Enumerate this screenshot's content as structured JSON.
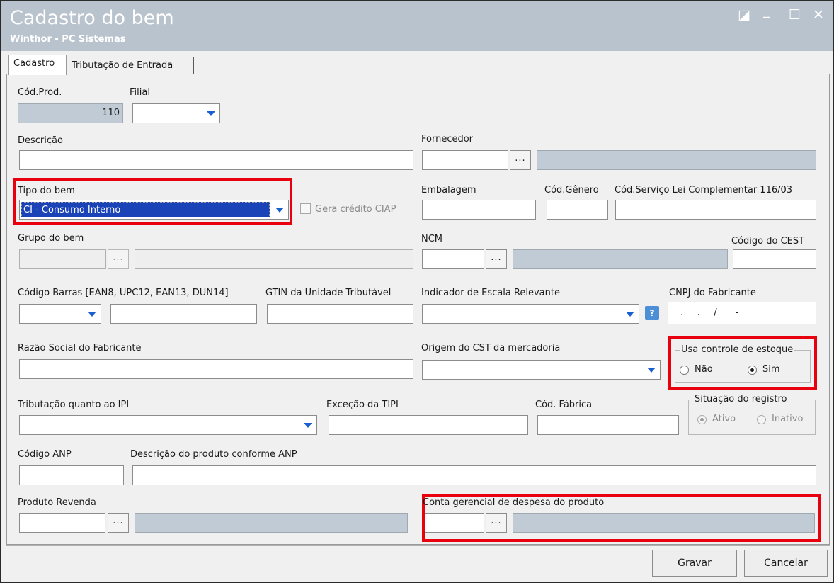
{
  "window": {
    "title": "Cadastro do bem",
    "subtitle": "Winthor - PC Sistemas",
    "restore_glyph": "◪",
    "minimize_glyph": "_",
    "maximize_glyph": "☐",
    "close_glyph": "✕"
  },
  "tabs": [
    {
      "label": "Cadastro",
      "active": true
    },
    {
      "label": "Tributação de Entrada",
      "active": false
    }
  ],
  "form": {
    "cod_prod": {
      "label": "Cód.Prod.",
      "value": "110"
    },
    "filial": {
      "label": "Filial",
      "value": ""
    },
    "descricao": {
      "label": "Descrição",
      "value": ""
    },
    "fornecedor": {
      "label": "Fornecedor",
      "value": "",
      "lookup_label": "..."
    },
    "tipo_bem": {
      "label": "Tipo do bem",
      "value": "CI - Consumo Interno"
    },
    "gera_credito": {
      "label": "Gera crédito CIAP",
      "checked": false
    },
    "embalagem": {
      "label": "Embalagem",
      "value": ""
    },
    "cod_genero": {
      "label": "Cód.Gênero",
      "value": ""
    },
    "cod_servico": {
      "label": "Cód.Serviço Lei Complementar 116/03",
      "value": ""
    },
    "grupo_bem": {
      "label": "Grupo do bem",
      "value": "",
      "lookup_label": "..."
    },
    "ncm": {
      "label": "NCM",
      "value": "",
      "lookup_label": "..."
    },
    "codigo_cest": {
      "label": "Código do CEST",
      "value": ""
    },
    "codigo_barras": {
      "label": "Código Barras [EAN8, UPC12, EAN13, DUN14]",
      "value": ""
    },
    "gtin": {
      "label": "GTIN da Unidade Tributável",
      "value": ""
    },
    "indicador_escala": {
      "label": "Indicador de Escala Relevante",
      "value": ""
    },
    "cnpj_fabricante": {
      "label": "CNPJ do Fabricante",
      "value": "__.___.___/____-__"
    },
    "razao_social": {
      "label": "Razão Social do Fabricante",
      "value": ""
    },
    "origem_cst": {
      "label": "Origem do CST da mercadoria",
      "value": ""
    },
    "controle_estoque": {
      "label": "Usa controle de estoque",
      "opt_nao": "Não",
      "opt_sim": "Sim",
      "selected": "Sim"
    },
    "tributacao_ipi": {
      "label": "Tributação quanto ao IPI",
      "value": ""
    },
    "excecao_tipi": {
      "label": "Exceção da TIPI",
      "value": ""
    },
    "cod_fabrica": {
      "label": "Cód. Fábrica",
      "value": ""
    },
    "situacao": {
      "label": "Situação do registro",
      "opt_ativo": "Ativo",
      "opt_inativo": "Inativo",
      "selected": "Ativo"
    },
    "codigo_anp": {
      "label": "Código ANP",
      "value": ""
    },
    "descricao_anp": {
      "label": "Descrição do produto conforme ANP",
      "value": ""
    },
    "produto_revenda": {
      "label": "Produto Revenda",
      "value": "",
      "lookup_label": "..."
    },
    "conta_gerencial": {
      "label": "Conta gerencial de despesa do produto",
      "value": "",
      "lookup_label": "..."
    }
  },
  "buttons": {
    "gravar": {
      "first": "G",
      "rest": "ravar"
    },
    "cancelar": {
      "first": "C",
      "rest": "ancelar"
    }
  },
  "colors": {
    "highlight": "#e8000f",
    "titlebar": "#b9c3cd",
    "selection": "#1a43b8",
    "readonly_field": "#c0cbd6"
  }
}
